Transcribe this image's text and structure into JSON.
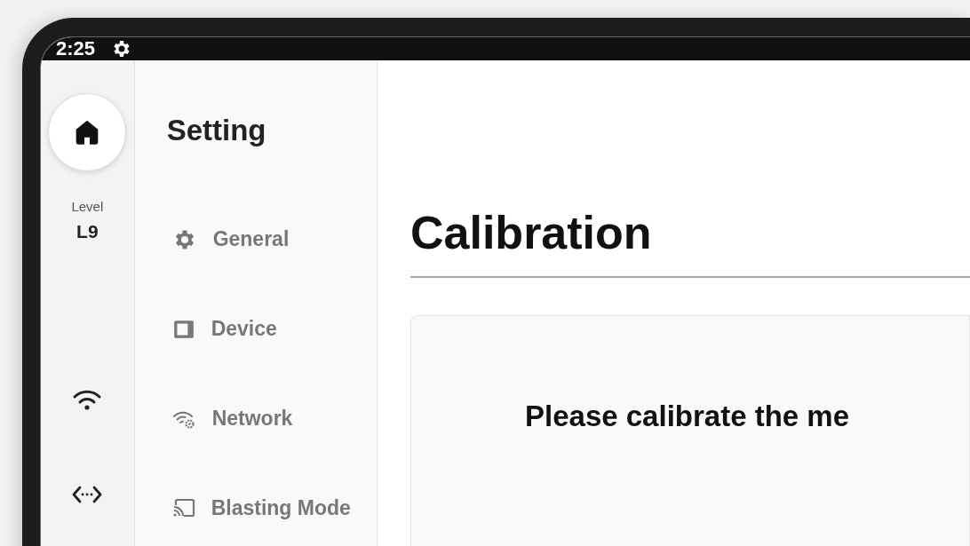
{
  "status_bar": {
    "time": "2:25"
  },
  "nav_rail": {
    "level_label": "Level",
    "level_value": "L9"
  },
  "settings": {
    "title": "Setting",
    "items": [
      {
        "label": "General",
        "kind": "gear"
      },
      {
        "label": "Device",
        "kind": "device"
      },
      {
        "label": "Network",
        "kind": "network"
      },
      {
        "label": "Blasting Mode",
        "kind": "cast"
      }
    ]
  },
  "content": {
    "title": "Calibration",
    "message": "Please calibrate the me"
  }
}
